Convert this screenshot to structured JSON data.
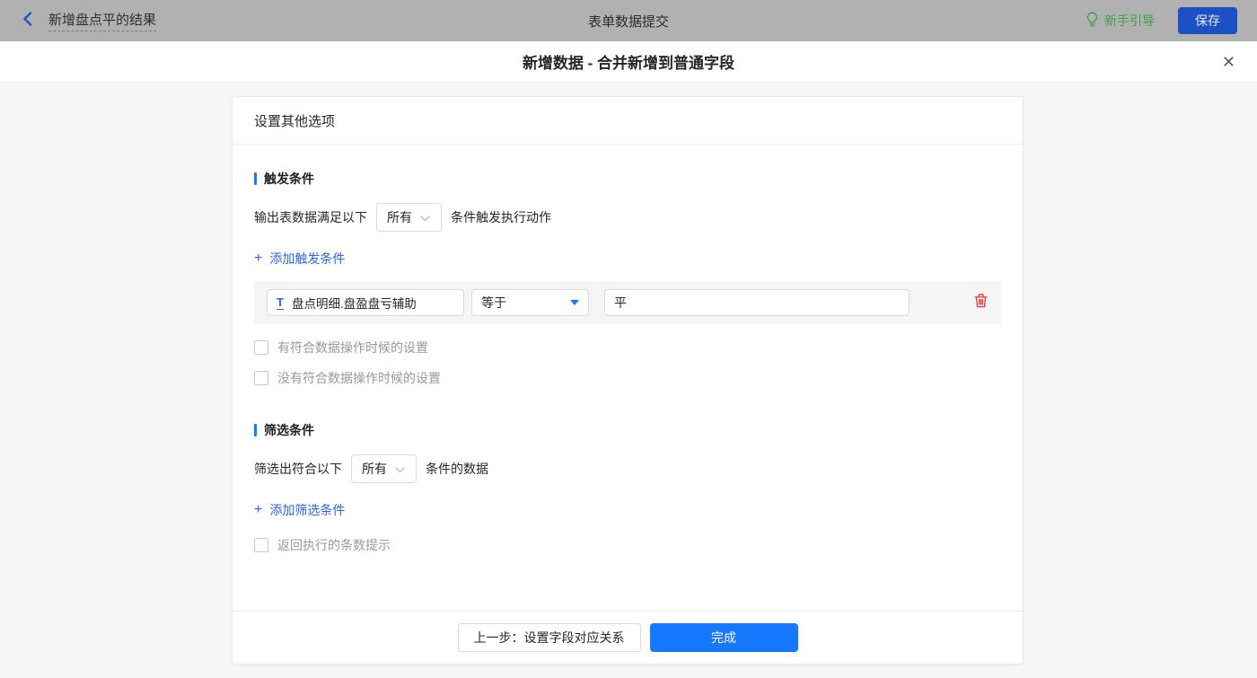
{
  "topbar": {
    "title": "新增盘点平的结果",
    "center_title": "表单数据提交",
    "guide_label": "新手引导",
    "save_label": "保存"
  },
  "modal": {
    "title": "新增数据 - 合并新增到普通字段",
    "close_icon": "✕"
  },
  "icons": {
    "plus": "+"
  },
  "card": {
    "header": "设置其他选项",
    "trigger_section": {
      "title": "触发条件",
      "sentence_prefix": "输出表数据满足以下",
      "match_select_value": "所有",
      "sentence_suffix": "条件触发执行动作",
      "add_link": "添加触发条件",
      "condition": {
        "field_icon": "T",
        "field_value": "盘点明细.盘盈盘亏辅助",
        "operator_value": "等于",
        "value": "平"
      },
      "checkboxes": [
        {
          "label": "有符合数据操作时候的设置",
          "checked": false
        },
        {
          "label": "没有符合数据操作时候的设置",
          "checked": false
        }
      ]
    },
    "filter_section": {
      "title": "筛选条件",
      "sentence_prefix": "筛选出符合以下",
      "match_select_value": "所有",
      "sentence_suffix": "条件的数据",
      "add_link": "添加筛选条件",
      "checkbox": {
        "label": "返回执行的条数提示",
        "checked": false
      }
    },
    "footer": {
      "prev_label": "上一步：设置字段对应关系",
      "finish_label": "完成"
    }
  },
  "colors": {
    "accent_blue": "#1677ff",
    "link_blue": "#2e63f6",
    "save_blue": "#1d50c6",
    "guide_green": "#3f9f42",
    "delete_red": "#f5222d",
    "topbar_gray": "#b1b1b1"
  }
}
